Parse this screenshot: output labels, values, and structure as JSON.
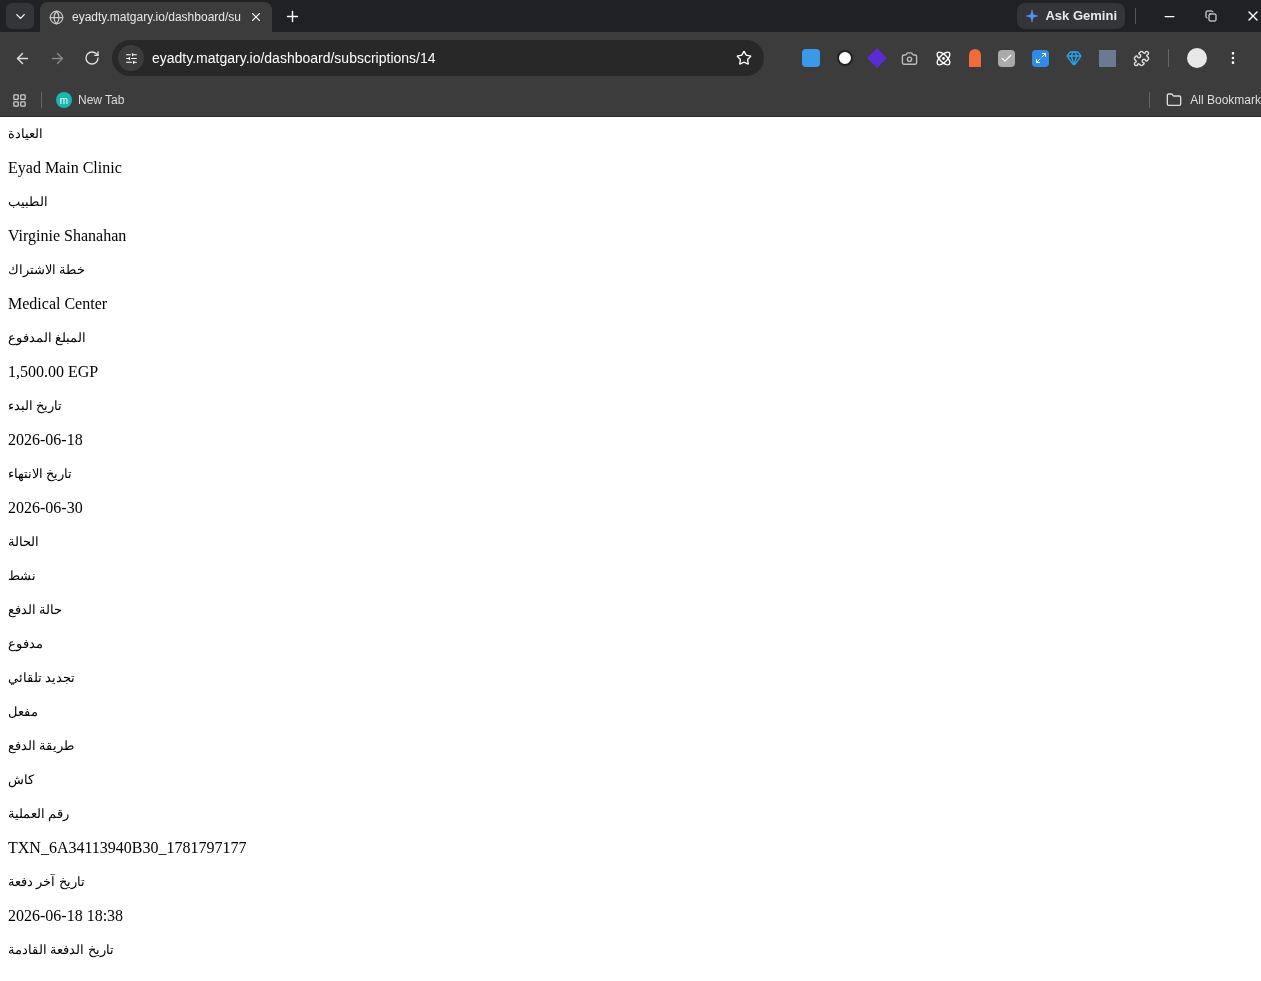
{
  "browser": {
    "tab": {
      "title": "eyadty.matgary.io/dashboard/su",
      "selected": true
    },
    "ask_button": "Ask Gemini",
    "url": "eyadty.matgary.io/dashboard/subscriptions/14",
    "bookmarks": [
      {
        "label": "New Tab",
        "icon_letter": "m"
      }
    ],
    "all_bookmarks": "All Bookmark"
  },
  "details": [
    {
      "label": "العيادة",
      "value": "Eyad Main Clinic"
    },
    {
      "label": "الطبيب",
      "value": "Virginie Shanahan"
    },
    {
      "label": "خطة الاشتراك",
      "value": "Medical Center"
    },
    {
      "label": "المبلغ المدفوع",
      "value": "1,500.00 EGP"
    },
    {
      "label": "تاريخ البدء",
      "value": "2026-06-18"
    },
    {
      "label": "تاريخ الانتهاء",
      "value": "2026-06-30"
    },
    {
      "label": "الحالة",
      "value": "نشط"
    },
    {
      "label": "حالة الدفع",
      "value": "مدفوع"
    },
    {
      "label": "تجديد تلقائي",
      "value": "مفعل"
    },
    {
      "label": "طريقة الدفع",
      "value": "كاش"
    },
    {
      "label": "رقم العملية",
      "value": "TXN_6A34113940B30_1781797177"
    },
    {
      "label": "تاريخ آخر دفعة",
      "value": "2026-06-18 18:38"
    },
    {
      "label": "تاريخ الدفعة القادمة"
    }
  ]
}
